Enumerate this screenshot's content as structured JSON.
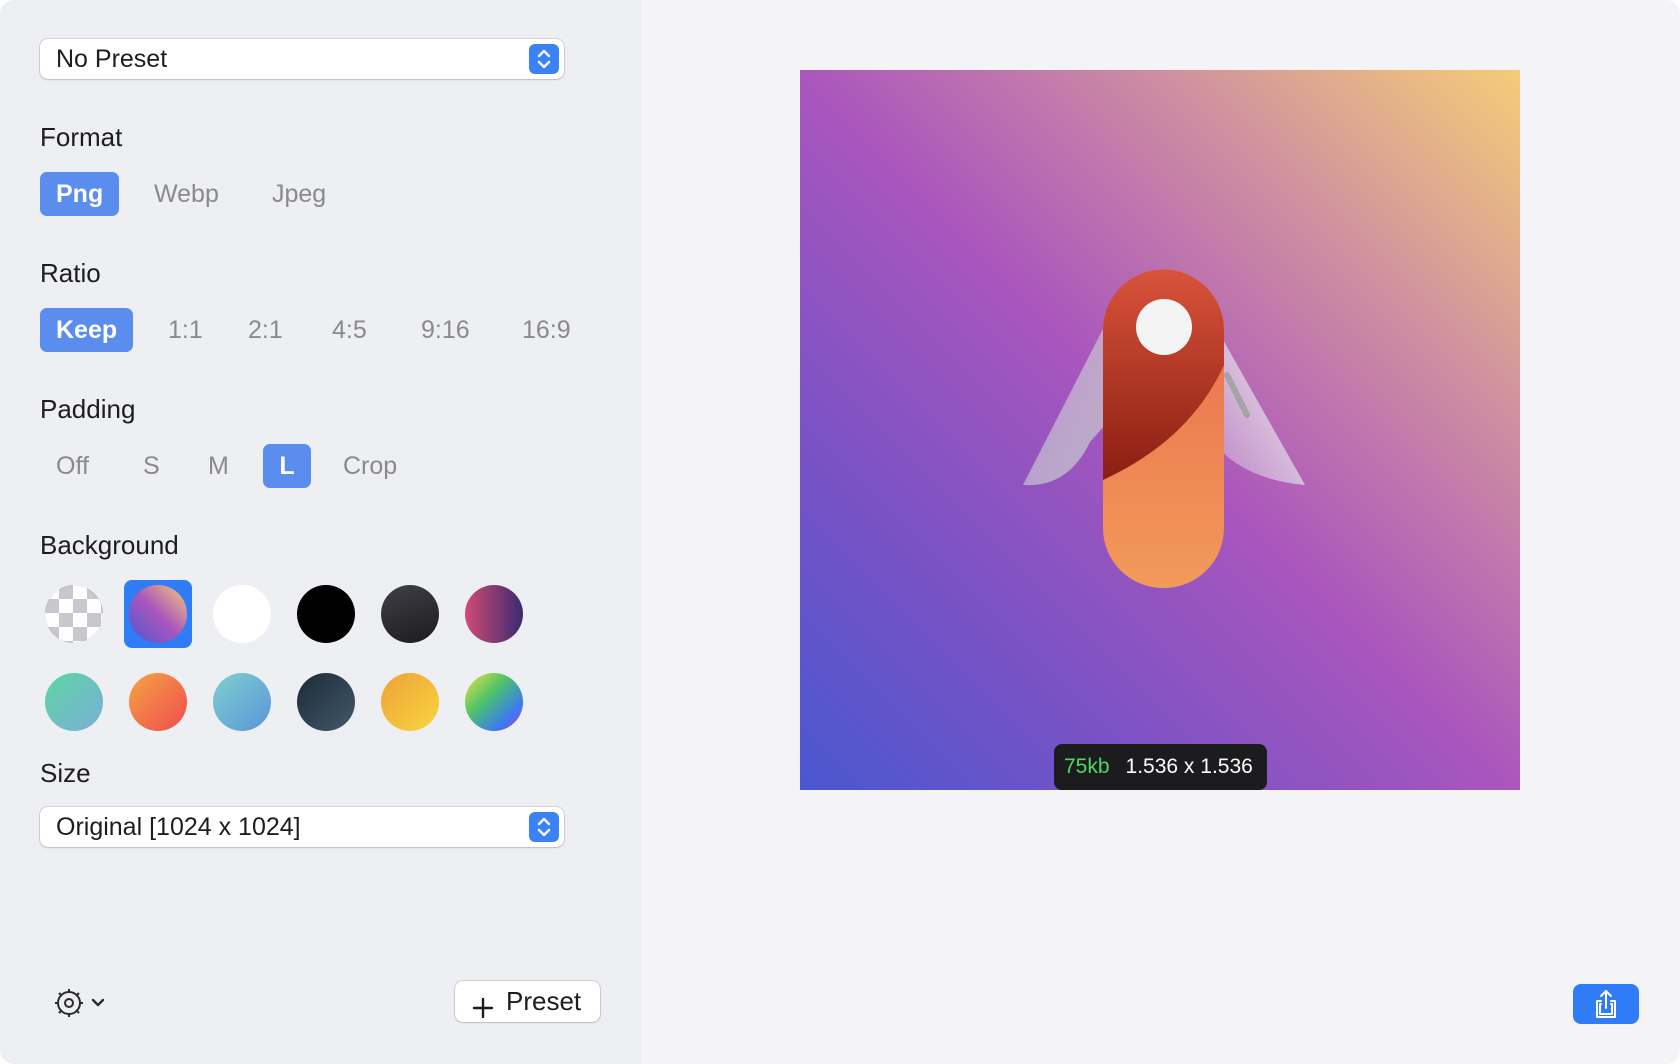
{
  "preset_select": {
    "value": "No Preset",
    "icon": "up-down-chevron-icon"
  },
  "format": {
    "label": "Format",
    "options": [
      "Png",
      "Webp",
      "Jpeg"
    ],
    "selected": "Png"
  },
  "ratio": {
    "label": "Ratio",
    "options": [
      "Keep",
      "1:1",
      "2:1",
      "4:5",
      "9:16",
      "16:9"
    ],
    "selected": "Keep"
  },
  "padding": {
    "label": "Padding",
    "options": [
      "Off",
      "S",
      "M",
      "L",
      "Crop"
    ],
    "selected": "L"
  },
  "background": {
    "label": "Background",
    "selected_index": 1,
    "swatches": [
      {
        "kind": "transparent-checker"
      },
      {
        "kind": "gradient",
        "colors": [
          "#4a57cf",
          "#aa56bd",
          "#f4cd77"
        ]
      },
      {
        "kind": "solid",
        "colors": [
          "#ffffff"
        ]
      },
      {
        "kind": "solid",
        "colors": [
          "#000000"
        ]
      },
      {
        "kind": "gradient",
        "colors": [
          "#3a3b40",
          "#1c1c1f"
        ]
      },
      {
        "kind": "gradient",
        "colors": [
          "#d24b74",
          "#3a2a70"
        ]
      },
      {
        "kind": "gradient",
        "colors": [
          "#5ed6a2",
          "#7aaed8"
        ]
      },
      {
        "kind": "gradient",
        "colors": [
          "#f6a443",
          "#ee4b4f"
        ]
      },
      {
        "kind": "gradient",
        "colors": [
          "#7fd0d0",
          "#5a95d8"
        ]
      },
      {
        "kind": "gradient",
        "colors": [
          "#1c2a36",
          "#43596a"
        ]
      },
      {
        "kind": "gradient",
        "colors": [
          "#eea13a",
          "#f8d63e"
        ]
      },
      {
        "kind": "rainbow",
        "colors": [
          "#f0e040",
          "#4cc36a",
          "#3a7cf0",
          "#b03ad0"
        ]
      }
    ]
  },
  "size": {
    "label": "Size",
    "value": "Original [1024 x 1024]",
    "icon": "up-down-chevron-icon"
  },
  "footer": {
    "settings_icon": "gear-icon",
    "dropdown_icon": "chevron-down-icon",
    "add_preset_label": "Preset",
    "add_preset_icon": "plus-icon"
  },
  "preview": {
    "file_size": "75kb",
    "dimensions": "1.536 x 1.536",
    "share_icon": "share-icon"
  },
  "colors": {
    "accent": "#5b8def",
    "accent_strong": "#2f7cf6",
    "file_size_text": "#4cd964"
  }
}
